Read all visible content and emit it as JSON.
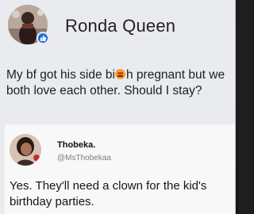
{
  "post": {
    "author_name": "Ronda Queen",
    "text_line1_before_emoji": "My bf got his side bi",
    "emoji_icon": "angry-face-icon",
    "text_line1_after_emoji": "h pregnant but we",
    "text_line2": "both love each other. Should I stay?",
    "verified_icon": "thumbs-up-badge-icon"
  },
  "reply": {
    "author_name": "Thobeka.",
    "handle": "@MsThobekaa",
    "text_line1": "Yes. They'll need a clown for the kid's",
    "text_line2": "birthday parties."
  },
  "colors": {
    "card_background": "#e9ebee",
    "reply_background": "#f8f8f9",
    "badge_blue": "#1d6fe0",
    "handle_gray": "#7b8087"
  }
}
